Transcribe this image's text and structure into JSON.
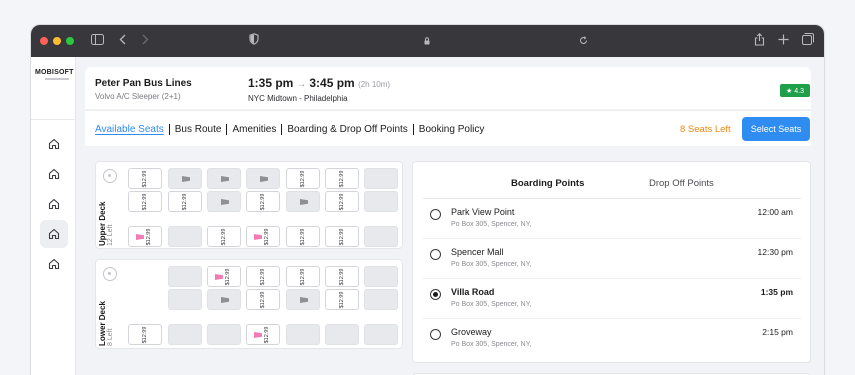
{
  "app": {
    "logo": "MOBISOFT"
  },
  "trip": {
    "operator": "Peter Pan Bus Lines",
    "bus_type": "Volvo A/C Sleeper (2+1)",
    "depart": "1:35 pm",
    "arrive": "3:45 pm",
    "duration": "(2h 10m)",
    "route": "NYC Midtown - Philadelphia",
    "rating": "★ 4.3"
  },
  "tabs": [
    "Available Seats",
    "Bus Route",
    "Amenities",
    "Boarding & Drop Off Points",
    "Booking Policy"
  ],
  "seats_left": "8 Seats Left",
  "select_button": "Select Seats",
  "decks": {
    "upper": {
      "title": "Upper Deck",
      "subtitle": "12 Left",
      "rows": [
        [
          "$12.99",
          "booked",
          "booked",
          "booked",
          "$12.99",
          "$12.99",
          "empty"
        ],
        [
          "$12.99",
          "$12.99",
          "booked",
          "$12.99",
          "booked",
          "$12.99",
          "empty"
        ],
        [
          "ladies:$12.99",
          "empty",
          "$12.99",
          "ladies:$12.99",
          "$12.99",
          "$12.99",
          "empty"
        ]
      ]
    },
    "lower": {
      "title": "Lower Deck",
      "subtitle": "8 Left",
      "rows": [
        [
          "none",
          "empty",
          "ladies:$12.99",
          "$12.99",
          "$12.99",
          "$12.99",
          "empty"
        ],
        [
          "none",
          "empty",
          "booked",
          "$12.99",
          "booked",
          "$12.99",
          "empty"
        ],
        [
          "$12.99",
          "empty",
          "empty",
          "ladies:$12.99",
          "empty",
          "empty",
          "empty"
        ]
      ]
    }
  },
  "boarding": {
    "tab_active": "Boarding Points",
    "tab_inactive": "Drop Off Points",
    "stops": [
      {
        "name": "Park View Point",
        "address": "Po Box 305, Spencer, NY,",
        "time": "12:00 am",
        "selected": false
      },
      {
        "name": "Spencer Mall",
        "address": "Po Box 305, Spencer, NY,",
        "time": "12:30 pm",
        "selected": false
      },
      {
        "name": "Villa Road",
        "address": "Po Box 305, Spencer, NY,",
        "time": "1:35 pm",
        "selected": true
      },
      {
        "name": "Groveway",
        "address": "Po Box 305, Spencer, NY,",
        "time": "2:15 pm",
        "selected": false
      }
    ]
  },
  "colors": {
    "accent": "#2f8cf0",
    "rating": "#21a04a",
    "seats_left": "#f0870f",
    "ladies": "#f27bb3"
  }
}
